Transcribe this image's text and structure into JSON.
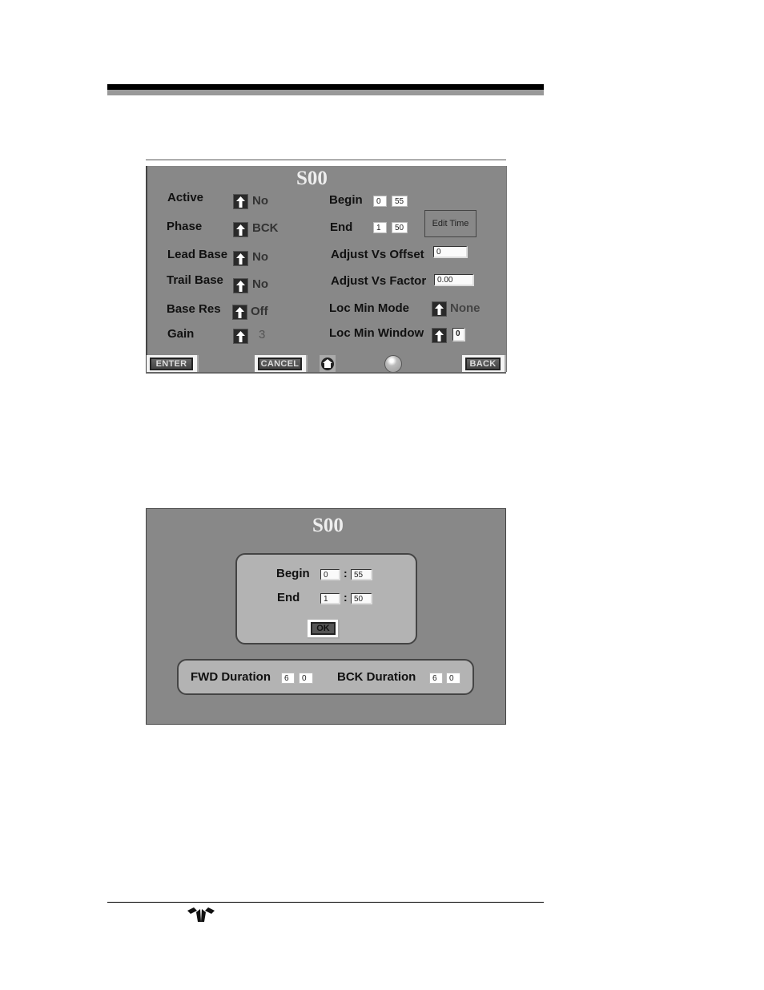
{
  "screen1": {
    "title": "S00",
    "left_fields": [
      {
        "label": "Active",
        "value": "No"
      },
      {
        "label": "Phase",
        "value": "BCK"
      },
      {
        "label": "Lead Base",
        "value": "No"
      },
      {
        "label": "Trail Base",
        "value": "No"
      },
      {
        "label": "Base Res",
        "value": "Off"
      },
      {
        "label": "Gain",
        "value": "3"
      }
    ],
    "begin": {
      "label": "Begin",
      "minutes": "0",
      "seconds": "55"
    },
    "end": {
      "label": "End",
      "minutes": "1",
      "seconds": "50"
    },
    "edit_time_label": "Edit Time",
    "adjust_vs_offset": {
      "label": "Adjust Vs Offset",
      "value": "0"
    },
    "adjust_vs_factor": {
      "label": "Adjust Vs Factor",
      "value": "0.00"
    },
    "loc_min_mode": {
      "label": "Loc Min Mode",
      "value": "None"
    },
    "loc_min_window": {
      "label": "Loc Min Window",
      "value": "0"
    },
    "footer": {
      "enter": "ENTER",
      "cancel": "CANCEL",
      "back": "BACK"
    }
  },
  "screen2": {
    "title": "S00",
    "begin": {
      "label": "Begin",
      "minutes": "0",
      "seconds": "55"
    },
    "end": {
      "label": "End",
      "minutes": "1",
      "seconds": "50"
    },
    "separator": ":",
    "ok_label": "OK",
    "fwd_duration": {
      "label": "FWD Duration",
      "a": "6",
      "b": "0"
    },
    "bck_duration": {
      "label": "BCK Duration",
      "a": "6",
      "b": "0"
    }
  },
  "icons": {
    "up_arrow": "up-arrow-icon",
    "home": "home-icon",
    "logo": "teledyne-logo-icon"
  }
}
